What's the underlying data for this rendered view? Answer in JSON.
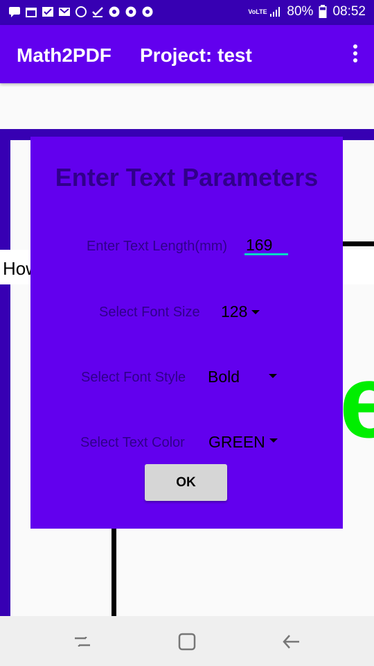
{
  "status_bar": {
    "network": "VoLTE",
    "battery": "80%",
    "time": "08:52"
  },
  "app_bar": {
    "app_title": "Math2PDF",
    "project_title": "Project: test"
  },
  "background": {
    "howto_text": "How",
    "glyph": "e",
    "glyph_color": "#00ee00"
  },
  "dialog": {
    "title": "Enter Text Parameters",
    "length_label": "Enter Text Length(mm)",
    "length_value": "169",
    "font_size_label": "Select Font Size",
    "font_size_value": "128",
    "font_style_label": "Select Font Style",
    "font_style_value": "Bold",
    "text_color_label": "Select Text Color",
    "text_color_value": "GREEN",
    "ok_label": "OK"
  },
  "colors": {
    "primary": "#6200ee",
    "primary_dark": "#3700b3",
    "accent": "#03dac5"
  }
}
